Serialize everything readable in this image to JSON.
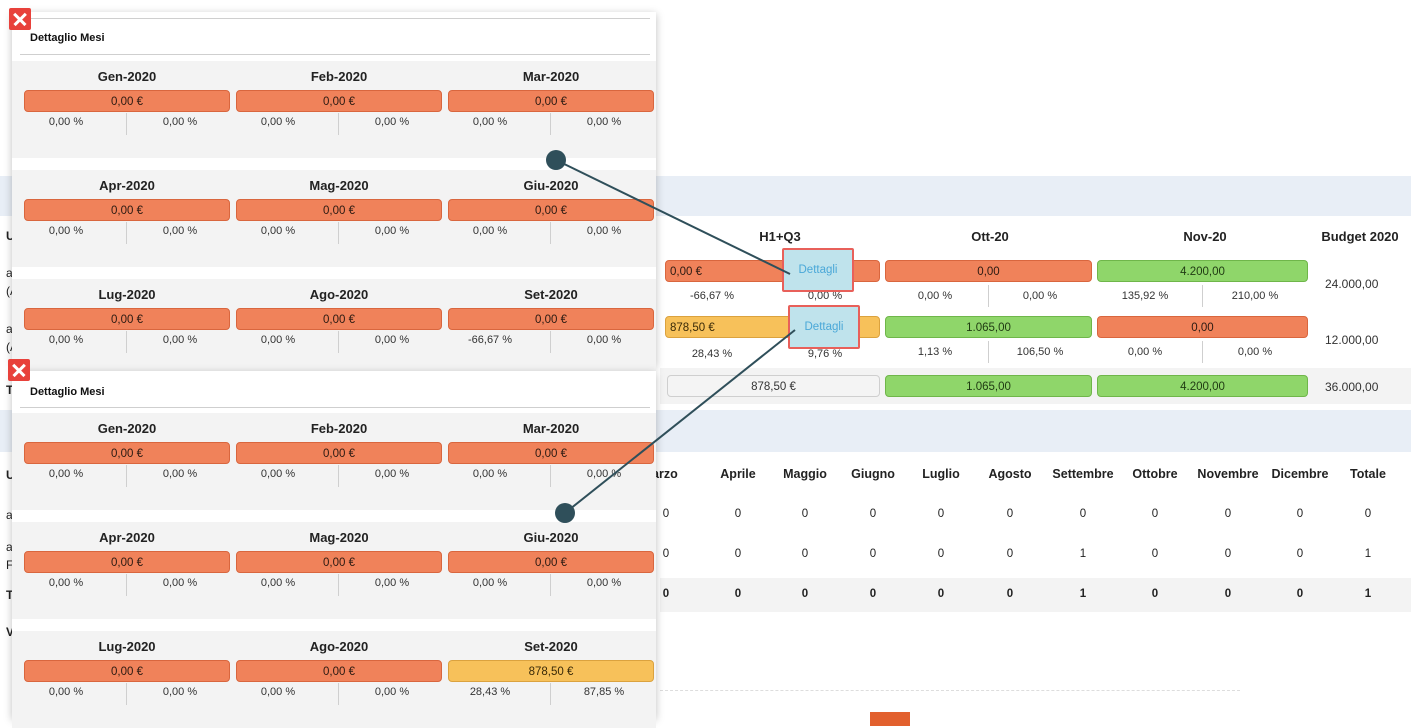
{
  "header_cols": {
    "h1q3": "H1+Q3",
    "ott": "Ott-20",
    "nov": "Nov-20",
    "budget": "Budget 2020"
  },
  "rows": [
    {
      "h1q3_value": "0,00 €",
      "h1q3_p1": "-66,67 %",
      "h1q3_p2": "0,00 %",
      "ott_value": "0,00",
      "ott_p1": "0,00 %",
      "ott_p2": "0,00 %",
      "nov_value": "4.200,00",
      "nov_p1": "135,92 %",
      "nov_p2": "210,00 %",
      "budget": "24.000,00",
      "details": "Dettagli"
    },
    {
      "h1q3_value": "878,50 €",
      "h1q3_p1": "28,43 %",
      "h1q3_p2": "9,76 %",
      "ott_value": "1.065,00",
      "ott_p1": "1,13 %",
      "ott_p2": "106,50 %",
      "nov_value": "0,00",
      "nov_p1": "0,00 %",
      "nov_p2": "0,00 %",
      "budget": "12.000,00",
      "details": "Dettagli"
    }
  ],
  "totals": {
    "h1q3": "878,50 €",
    "ott": "1.065,00",
    "nov": "4.200,00",
    "budget": "36.000,00"
  },
  "count_table": {
    "headers": [
      "arzo",
      "Aprile",
      "Maggio",
      "Giugno",
      "Luglio",
      "Agosto",
      "Settembre",
      "Ottobre",
      "Novembre",
      "Dicembre",
      "Totale"
    ],
    "rows": [
      [
        "0",
        "0",
        "0",
        "0",
        "0",
        "0",
        "0",
        "0",
        "0",
        "0",
        "0"
      ],
      [
        "0",
        "0",
        "0",
        "0",
        "0",
        "0",
        "1",
        "0",
        "0",
        "0",
        "1"
      ],
      [
        "0",
        "0",
        "0",
        "0",
        "0",
        "0",
        "1",
        "0",
        "0",
        "0",
        "1"
      ]
    ]
  },
  "left_fragments": [
    "Ut",
    "au",
    "(A",
    "au",
    "(A",
    "To",
    "Us",
    "au",
    "au",
    "Fa",
    "To",
    "Vi"
  ],
  "popup_top": {
    "title": "Dettaglio Mesi",
    "months": [
      {
        "label": "Gen-2020",
        "value": "0,00 €",
        "p1": "0,00 %",
        "p2": "0,00 %",
        "color": "red"
      },
      {
        "label": "Feb-2020",
        "value": "0,00 €",
        "p1": "0,00 %",
        "p2": "0,00 %",
        "color": "red"
      },
      {
        "label": "Mar-2020",
        "value": "0,00 €",
        "p1": "0,00 %",
        "p2": "0,00 %",
        "color": "red"
      },
      {
        "label": "Apr-2020",
        "value": "0,00 €",
        "p1": "0,00 %",
        "p2": "0,00 %",
        "color": "red"
      },
      {
        "label": "Mag-2020",
        "value": "0,00 €",
        "p1": "0,00 %",
        "p2": "0,00 %",
        "color": "red"
      },
      {
        "label": "Giu-2020",
        "value": "0,00 €",
        "p1": "0,00 %",
        "p2": "0,00 %",
        "color": "red"
      },
      {
        "label": "Lug-2020",
        "value": "0,00 €",
        "p1": "0,00 %",
        "p2": "0,00 %",
        "color": "red"
      },
      {
        "label": "Ago-2020",
        "value": "0,00 €",
        "p1": "0,00 %",
        "p2": "0,00 %",
        "color": "red"
      },
      {
        "label": "Set-2020",
        "value": "0,00 €",
        "p1": "-66,67 %",
        "p2": "0,00 %",
        "color": "red"
      }
    ]
  },
  "popup_bottom": {
    "title": "Dettaglio Mesi",
    "months": [
      {
        "label": "Gen-2020",
        "value": "0,00 €",
        "p1": "0,00 %",
        "p2": "0,00 %",
        "color": "red"
      },
      {
        "label": "Feb-2020",
        "value": "0,00 €",
        "p1": "0,00 %",
        "p2": "0,00 %",
        "color": "red"
      },
      {
        "label": "Mar-2020",
        "value": "0,00 €",
        "p1": "0,00 %",
        "p2": "0,00 %",
        "color": "red"
      },
      {
        "label": "Apr-2020",
        "value": "0,00 €",
        "p1": "0,00 %",
        "p2": "0,00 %",
        "color": "red"
      },
      {
        "label": "Mag-2020",
        "value": "0,00 €",
        "p1": "0,00 %",
        "p2": "0,00 %",
        "color": "red"
      },
      {
        "label": "Giu-2020",
        "value": "0,00 €",
        "p1": "0,00 %",
        "p2": "0,00 %",
        "color": "red"
      },
      {
        "label": "Lug-2020",
        "value": "0,00 €",
        "p1": "0,00 %",
        "p2": "0,00 %",
        "color": "red"
      },
      {
        "label": "Ago-2020",
        "value": "0,00 €",
        "p1": "0,00 %",
        "p2": "0,00 %",
        "color": "red"
      },
      {
        "label": "Set-2020",
        "value": "878,50 €",
        "p1": "28,43 %",
        "p2": "87,85 %",
        "color": "yellow"
      }
    ]
  },
  "colors": {
    "negative": "#f0825a",
    "positive": "#8fd66a",
    "warning": "#f7c15a",
    "close": "#e8413b",
    "connector": "#2f4f5a"
  }
}
